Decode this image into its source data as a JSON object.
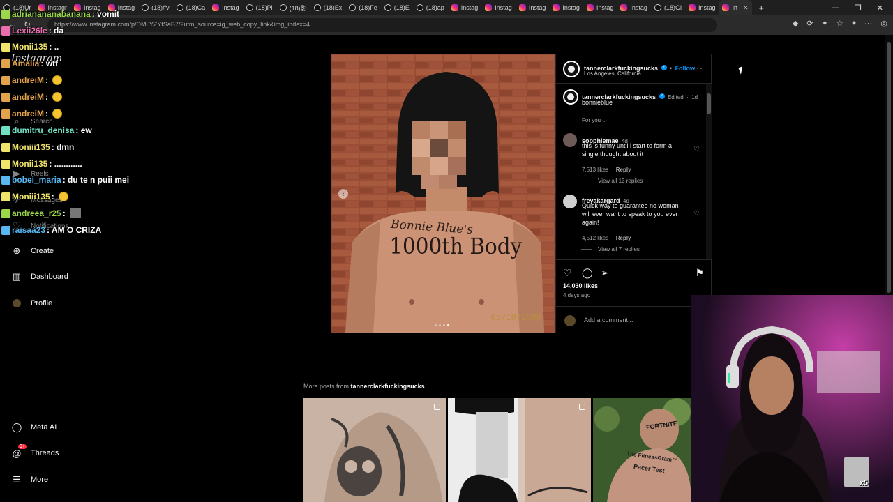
{
  "browser": {
    "tabs": [
      {
        "label": "(18)Ur",
        "kind": "tt"
      },
      {
        "label": "Instagr",
        "kind": "ig"
      },
      {
        "label": "Instag",
        "kind": "ig"
      },
      {
        "label": "Instag",
        "kind": "ig"
      },
      {
        "label": "(18)#v",
        "kind": "tt"
      },
      {
        "label": "(18)Ca",
        "kind": "tt"
      },
      {
        "label": "Instag",
        "kind": "ig"
      },
      {
        "label": "(18)Pi",
        "kind": "tt"
      },
      {
        "label": "(18)影",
        "kind": "tt"
      },
      {
        "label": "(18)Ex",
        "kind": "tt"
      },
      {
        "label": "(18)Fe",
        "kind": "tt"
      },
      {
        "label": "(18)E",
        "kind": "tt"
      },
      {
        "label": "(18)ap",
        "kind": "tt"
      },
      {
        "label": "Instag",
        "kind": "ig"
      },
      {
        "label": "Instag",
        "kind": "ig"
      },
      {
        "label": "Instag",
        "kind": "ig"
      },
      {
        "label": "Instag",
        "kind": "ig"
      },
      {
        "label": "Instag",
        "kind": "ig"
      },
      {
        "label": "Instag",
        "kind": "ig"
      },
      {
        "label": "(18)Gi",
        "kind": "tt"
      },
      {
        "label": "Instag",
        "kind": "ig"
      }
    ],
    "active_tab": "In",
    "url": "https://www.instagram.com/p/DMLYZYtSaB7/?utm_source=ig_web_copy_link&img_index=4"
  },
  "sidebar": {
    "logo": "Instagram",
    "items": [
      {
        "label": "Search",
        "icon": "search-icon"
      },
      {
        "label": "Reels",
        "icon": "reels-icon"
      },
      {
        "label": "Messages",
        "icon": "messages-icon"
      },
      {
        "label": "Notifications",
        "icon": "heart-icon"
      },
      {
        "label": "Create",
        "icon": "plus-icon"
      },
      {
        "label": "Dashboard",
        "icon": "dashboard-icon"
      },
      {
        "label": "Profile",
        "icon": "avatar-icon"
      },
      {
        "label": "Meta AI",
        "icon": "meta-ai-icon"
      },
      {
        "label": "Threads",
        "icon": "threads-icon",
        "badge": "9+"
      },
      {
        "label": "More",
        "icon": "menu-icon"
      }
    ]
  },
  "chat": [
    {
      "user": "adrianananabanana",
      "msg": ": vomit",
      "color": "#9bd74a"
    },
    {
      "user": "Lexii26le",
      "msg": ": da",
      "color": "#e96fb1"
    },
    {
      "user": "Monii135",
      "msg": ": ..",
      "color": "#f0e46a"
    },
    {
      "user": "Amalia",
      "msg": ": wtf",
      "color": "#e3a24c"
    },
    {
      "user": "andreiM",
      "msg": ":",
      "color": "#e3a24c"
    },
    {
      "user": "andreiM",
      "msg": ":",
      "color": "#e3a24c"
    },
    {
      "user": "andreiM",
      "msg": ":",
      "color": "#e3a24c"
    },
    {
      "user": "dumitru_denisa",
      "msg": ": ew",
      "color": "#6fe0c4"
    },
    {
      "user": "Moniii135",
      "msg": ": dmn",
      "color": "#f0e46a"
    },
    {
      "user": "Monii135",
      "msg": ": ............",
      "color": "#f0e46a"
    },
    {
      "user": "bobei_maria",
      "msg": ": du te n puii mei",
      "color": "#58b6f0"
    },
    {
      "user": "Moniii135",
      "msg": ":",
      "color": "#f0e46a"
    },
    {
      "user": "andreea_r25",
      "msg": ":",
      "color": "#9bd74a"
    },
    {
      "user": "raisaa23",
      "msg": ": AM O CRIZA",
      "color": "#58b6f0"
    }
  ],
  "post": {
    "username": "tannerclarkfuckingsucks",
    "follow": "Follow",
    "location": "Los Angeles, California",
    "caption_user": "tannerclarkfuckingsucks",
    "caption_edited": "Edited",
    "caption_time": "1d",
    "caption": "bonnieblue",
    "for_you": "For you",
    "photo_tattoo_line1": "Bonnie Blue's",
    "photo_tattoo_line2": "1000th Body",
    "photo_date": "03/10/2009",
    "comments": [
      {
        "user": "sopphiemae",
        "time": "4d",
        "text": "this is funny until i start to form a single thought about it",
        "likes": "7,513 likes",
        "reply": "Reply",
        "view_replies": "View all 13 replies"
      },
      {
        "user": "freyakargard",
        "time": "4d",
        "text": "Quick way to guarantee no woman will ever want to speak to you ever again!",
        "likes": "4,512 likes",
        "reply": "Reply",
        "view_replies": "View all 7 replies"
      }
    ],
    "like_count": "14,030 likes",
    "posted_ago": "4 days ago",
    "add_comment_placeholder": "Add a comment..."
  },
  "more_posts": {
    "label_prefix": "More posts from",
    "username": "tannerclarkfuckingsucks",
    "thumb3_text_line1": "FORTNITE",
    "thumb3_text_line2": "The FitnessGram™",
    "thumb3_text_line3": "Pacer Test"
  },
  "stream": {
    "gift_multiplier": "x5"
  }
}
